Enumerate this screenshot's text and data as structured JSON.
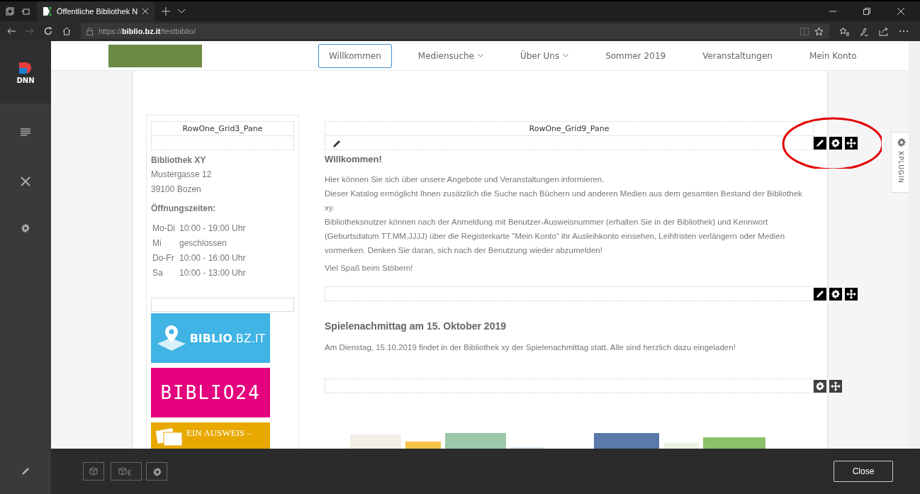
{
  "browser": {
    "tab_title": "Öffentliche Bibliothek N",
    "url": "https://**biblio.bz.it**/testbiblio/"
  },
  "dnn_sidebar": {
    "logo_text": "DNN"
  },
  "nav": {
    "items": [
      {
        "label": "Willkommen",
        "selected": true,
        "dropdown": false
      },
      {
        "label": "Mediensuche",
        "selected": false,
        "dropdown": true
      },
      {
        "label": "Über Uns",
        "selected": false,
        "dropdown": true
      },
      {
        "label": "Sommer 2019",
        "selected": false,
        "dropdown": false
      },
      {
        "label": "Veranstaltungen",
        "selected": false,
        "dropdown": false
      },
      {
        "label": "Mein Konto",
        "selected": false,
        "dropdown": false
      }
    ]
  },
  "left_pane": {
    "title": "RowOne_Grid3_Pane",
    "name": "Bibliothek XY",
    "address": [
      "Mustergasse 12",
      "39100 Bozen"
    ],
    "hours_heading": "Öffnungszeiten:",
    "hours": [
      {
        "day": "Mo-Di",
        "time": "10:00 - 19:00 Uhr"
      },
      {
        "day": "Mi",
        "time": "geschlossen"
      },
      {
        "day": "Do-Fr",
        "time": "10:00 - 16:00 Uhr"
      },
      {
        "day": "Sa",
        "time": "10:00 - 13:00 Uhr"
      }
    ],
    "banners": [
      {
        "kind": "biblio",
        "text": "**BIBLIO**.BZ.IT",
        "color": "#3fb4e5"
      },
      {
        "kind": "biblio24",
        "text": "BIBLIO24",
        "color": "#e5007d"
      },
      {
        "kind": "ausweis",
        "text": "EIN AUSWEIS –",
        "color": "#e8a800"
      }
    ]
  },
  "right_pane": {
    "title": "RowOne_Grid9_Pane",
    "modules": [
      {
        "kind": "text",
        "heading": "Willkommen!",
        "paragraphs": [
          "Hier können Sie sich über unsere Angebote und Veranstaltungen informieren.",
          "Dieser Katalog ermöglicht Ihnen zusätzlich die Suche nach Büchern und anderen Medien aus dem gesamten Bestand der Bibliothek xy.",
          "Bibliotheksnutzer können nach der Anmeldung mit Benutzer-Ausweisnummer (erhalten Sie in der Bibliothek) und Kennwort (Geburtsdatum TT.MM.JJJJ) über die Registerkarte \"Mein Konto\" ihr Ausleihkonto einsehen, Leihfristen verlängern oder Medien vormerken. Denken Sie daran, sich nach der Benutzung wieder abzumelden!",
          "Viel Spaß beim Stöbern!"
        ],
        "actions": [
          {
            "kind": "edit"
          },
          {
            "kind": "settings"
          },
          {
            "kind": "move"
          }
        ]
      },
      {
        "kind": "event",
        "heading": "Spielenachmittag am 15. Oktober 2019",
        "paragraphs": [
          "Am Dienstag, 15.10.2019 findet in der Bibliothek xy der Spielenachmittag statt. Alle sind herzlich dazu eingeladen!"
        ],
        "actions": [
          {
            "kind": "edit"
          },
          {
            "kind": "settings"
          },
          {
            "kind": "move"
          }
        ]
      },
      {
        "kind": "books",
        "actions": [
          {
            "kind": "settings"
          },
          {
            "kind": "move"
          }
        ]
      }
    ]
  },
  "xplugin": {
    "label": "XPLUGIN"
  },
  "edit_bar": {
    "close_label": "Close"
  }
}
